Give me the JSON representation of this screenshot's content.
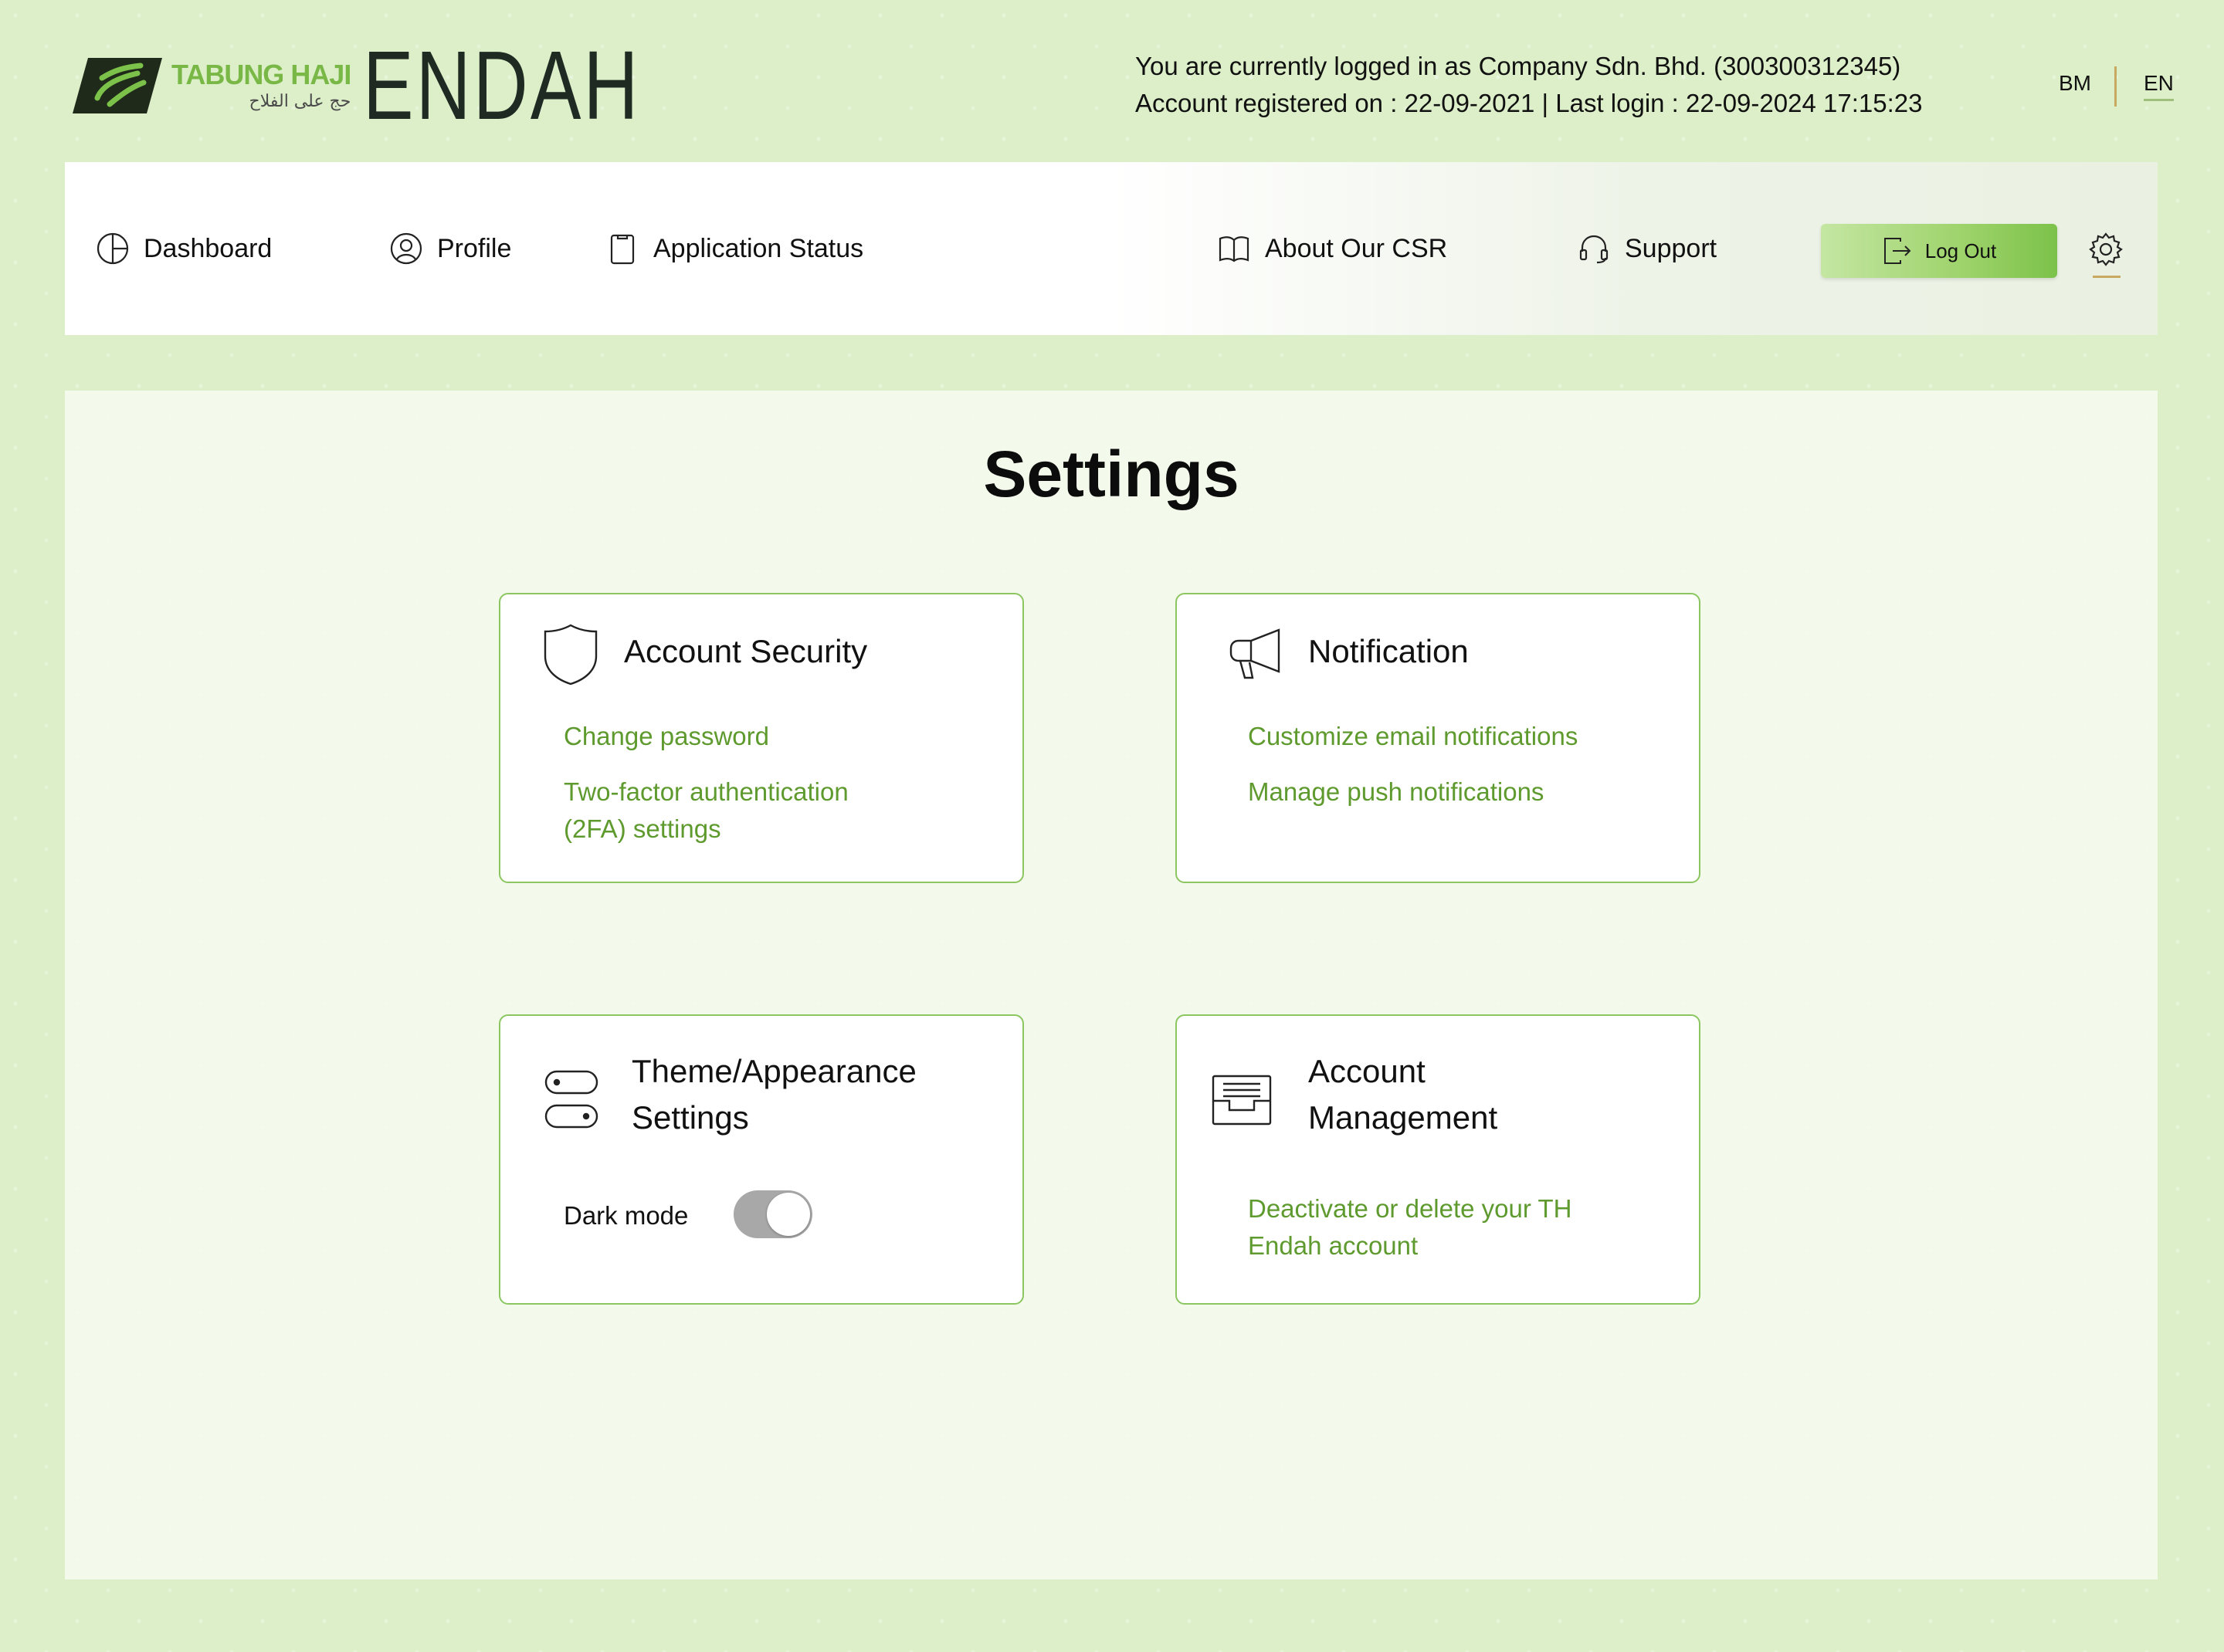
{
  "header": {
    "brand": "TABUNG HAJI",
    "brand_sub": "حج على الفلاح",
    "app_name": "ENDAH",
    "login_line1": "You are currently logged in as Company Sdn. Bhd. (300300312345)",
    "login_line2": "Account registered on : 22-09-2021 | Last login : 22-09-2024 17:15:23",
    "lang_bm": "BM",
    "lang_en": "EN",
    "active_lang": "EN"
  },
  "nav": {
    "dashboard": "Dashboard",
    "profile": "Profile",
    "application_status": "Application Status",
    "about_csr": "About Our CSR",
    "support": "Support",
    "logout": "Log Out",
    "icons": [
      "pie-chart-icon",
      "user-circle-icon",
      "clipboard-icon",
      "book-open-icon",
      "headset-icon",
      "logout-icon",
      "gear-icon"
    ]
  },
  "main": {
    "title": "Settings",
    "cards": {
      "security": {
        "title": "Account Security",
        "icon": "shield-icon",
        "links": [
          "Change password",
          "Two-factor authentication",
          "(2FA) settings"
        ]
      },
      "notification": {
        "title": "Notification",
        "icon": "megaphone-icon",
        "links": [
          "Customize email notifications",
          "Manage push notifications"
        ]
      },
      "theme": {
        "title_line1": "Theme/Appearance",
        "title_line2": "Settings",
        "icon": "toggles-icon",
        "dark_mode_label": "Dark mode",
        "dark_mode_enabled": false
      },
      "account": {
        "title_line1": "Account",
        "title_line2": "Management",
        "icon": "inbox-tray-icon",
        "link_line1": "Deactivate or delete your TH",
        "link_line2": "Endah account"
      }
    }
  },
  "colors": {
    "background": "#dcefc9",
    "accent_green": "#79b846",
    "link_green": "#5e9a2e",
    "card_border": "#8bc660",
    "gold": "#c9a860"
  }
}
